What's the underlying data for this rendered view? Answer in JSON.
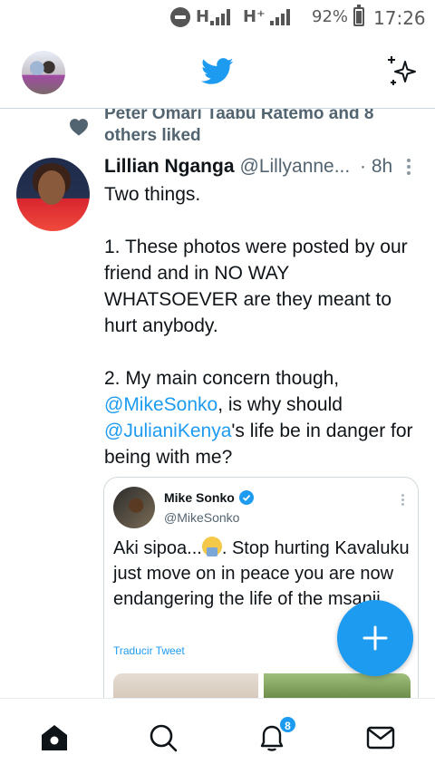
{
  "status_bar": {
    "network_1": "H",
    "network_2": "H⁺",
    "battery_percent": "92%",
    "battery_level": 0.92,
    "time": "17:26"
  },
  "header": {
    "account_avatar": "avatar-photo",
    "logo": "twitter-bird-icon",
    "action": "sparkle-icon"
  },
  "liked_context": {
    "icon": "heart-icon",
    "text": "Peter Omari Taabu Ratemo and 8 others liked"
  },
  "tweet": {
    "author_name": "Lillian Nganga",
    "author_handle": "@Lillyanne...",
    "time": "· 8h",
    "line1": "Two things.",
    "line2": "1. These photos were posted by our friend and in NO WAY WHATSOEVER are they meant to hurt anybody.",
    "line3_prefix": "2. My main concern though, ",
    "mention1": "@MikeSonko",
    "line3_mid": ", is why should ",
    "mention2": "@JulianiKenya",
    "line3_suffix": "'s life be in danger for being with me?"
  },
  "quoted_tweet": {
    "author_name": "Mike Sonko",
    "author_handle": "@MikeSonko",
    "text_before": "Aki sipoa...",
    "text_after": ". Stop hurting Kavaluku just move on in peace you are now endangering the life of the msanii.",
    "translate_label": "Traducir Tweet"
  },
  "fab": {
    "icon": "plus-icon"
  },
  "bottom_nav": {
    "items": [
      "home-icon",
      "search-icon",
      "notifications-icon",
      "messages-icon"
    ],
    "notification_count": "8"
  },
  "colors": {
    "accent": "#1d9bf0",
    "text": "#0f1419",
    "secondary": "#536471"
  }
}
